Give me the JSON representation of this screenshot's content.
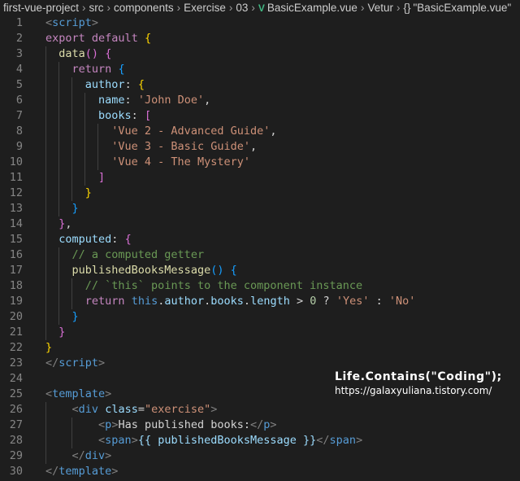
{
  "breadcrumb": {
    "items": [
      "first-vue-project",
      "src",
      "components",
      "Exercise",
      "03",
      "BasicExample.vue",
      "Vetur",
      "\"BasicExample.vue\""
    ]
  },
  "code": {
    "line_numbers": [
      "1",
      "2",
      "3",
      "4",
      "5",
      "6",
      "7",
      "8",
      "9",
      "10",
      "11",
      "12",
      "13",
      "14",
      "15",
      "16",
      "17",
      "18",
      "19",
      "20",
      "21",
      "22",
      "23",
      "24",
      "25",
      "26",
      "27",
      "28",
      "29",
      "30"
    ],
    "tokens": {
      "script_tag": "script",
      "export": "export",
      "default": "default",
      "data_fn": "data",
      "return": "return",
      "author": "author",
      "name": "name",
      "john": "'John Doe'",
      "books": "books",
      "book1": "'Vue 2 - Advanced Guide'",
      "book2": "'Vue 3 - Basic Guide'",
      "book3": "'Vue 4 - The Mystery'",
      "computed": "computed",
      "comment1": "// a computed getter",
      "method": "publishedBooksMessage",
      "comment2": "// `this` points to the component instance",
      "this": "this",
      "author_ref": "author",
      "books_ref": "books",
      "length": "length",
      "zero": "0",
      "yes": "'Yes'",
      "no": "'No'",
      "template_tag": "template",
      "div_tag": "div",
      "class_attr": "class",
      "class_val": "\"exercise\"",
      "p_tag": "p",
      "p_text": "Has published books:",
      "span_tag": "span",
      "mustache": "{{ publishedBooksMessage }}"
    }
  },
  "watermark": {
    "title": "Life.Contains(\"Coding\");",
    "url": "https://galaxyuliana.tistory.com/"
  }
}
